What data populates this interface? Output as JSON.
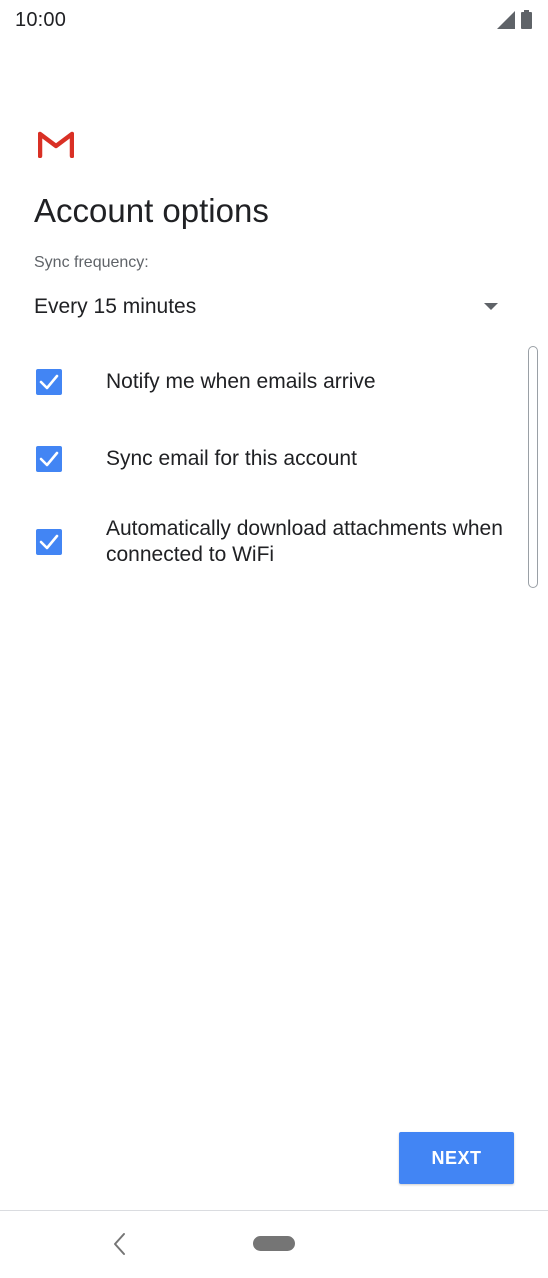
{
  "status_bar": {
    "time": "10:00",
    "icons": [
      "signal-icon",
      "battery-icon"
    ]
  },
  "header": {
    "logo": "gmail-logo-icon",
    "title": "Account options"
  },
  "sync": {
    "label": "Sync frequency:",
    "selected_value": "Every 15 minutes"
  },
  "options": [
    {
      "label": "Notify me when emails arrive",
      "checked": true
    },
    {
      "label": "Sync email for this account",
      "checked": true
    },
    {
      "label": "Automatically download attachments when connected to WiFi",
      "checked": true
    }
  ],
  "footer": {
    "next_label": "NEXT"
  },
  "colors": {
    "accent": "#4285f4",
    "text": "#202124",
    "secondary_text": "#5f6368",
    "gmail_red": "#d93025"
  },
  "nav_bar": {
    "icons": [
      "back-icon",
      "home-pill-icon"
    ]
  }
}
